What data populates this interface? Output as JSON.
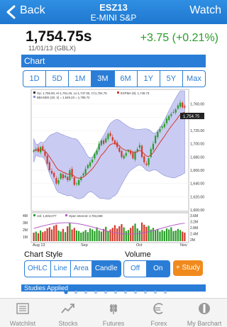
{
  "nav": {
    "back_label": "Back",
    "title": "ESZ13",
    "subtitle": "E-MINI S&P",
    "watch_label": "Watch"
  },
  "quote": {
    "price": "1,754.75s",
    "date": "11/01/13 (GBLX)",
    "change": "+3.75 (+0.21%)"
  },
  "chart_section": {
    "title": "Chart"
  },
  "ranges": [
    "1D",
    "5D",
    "1M",
    "3M",
    "6M",
    "1Y",
    "5Y",
    "Max"
  ],
  "selected_range": "3M",
  "legend": {
    "ohlc": "Op: 1,755.50, Hi:1,761.25, Lo:1,747.00, Cl:1,754.75",
    "bbands": "BBANDS (20, 2) = 1,649.23 = 1,795.72",
    "expma": "EXPMA (9): 1,749.73",
    "vol": "Vol: 1,603,077",
    "oi": "Open Interest: 2,784,838"
  },
  "price_axis": [
    "1,760.00",
    "1,740.00",
    "1,720.00",
    "1,700.00",
    "1,680.00",
    "1,660.00",
    "1,640.00",
    "1,620.00",
    "1,600.00"
  ],
  "last_price_tag": "1,754.75",
  "volume_axis_left": [
    "4M",
    "3M",
    "2M",
    "1M"
  ],
  "volume_axis_right": [
    "3.6M",
    "3.2M",
    "2.8M",
    "2.4M",
    "2M"
  ],
  "x_labels": [
    "Aug 13",
    "Sep",
    "Oct",
    "Nov"
  ],
  "chart_style": {
    "label": "Chart Style",
    "options": [
      "OHLC",
      "Line",
      "Area",
      "Candle"
    ],
    "selected": "Candle"
  },
  "volume_ctl": {
    "label": "Volume",
    "options": [
      "Off",
      "On"
    ],
    "selected": "On"
  },
  "study_button": "+ Study",
  "studies_applied": "Studies Applied",
  "tabs": [
    {
      "label": "Watchlist",
      "icon": "watchlist-icon"
    },
    {
      "label": "Stocks",
      "icon": "stocks-icon"
    },
    {
      "label": "Futures",
      "icon": "futures-icon"
    },
    {
      "label": "Forex",
      "icon": "forex-icon"
    },
    {
      "label": "My Barchart",
      "icon": "barchart-icon"
    }
  ],
  "colors": {
    "accent": "#2a7dd6",
    "up": "#2a9d2a",
    "down": "#d33a2c",
    "study": "#f08a1d"
  },
  "chart_data": {
    "type": "candlestick",
    "x_ticks": [
      "Aug 13",
      "Sep",
      "Oct",
      "Nov"
    ],
    "ylim": [
      1600,
      1780
    ],
    "closes": [
      1690,
      1692,
      1688,
      1695,
      1690,
      1682,
      1670,
      1660,
      1655,
      1650,
      1640,
      1645,
      1655,
      1648,
      1652,
      1645,
      1660,
      1650,
      1638,
      1640,
      1645,
      1650,
      1655,
      1662,
      1668,
      1672,
      1676,
      1685,
      1690,
      1700,
      1705,
      1700,
      1708,
      1715,
      1712,
      1705,
      1700,
      1695,
      1688,
      1680,
      1682,
      1686,
      1690,
      1685,
      1678,
      1688,
      1692,
      1698,
      1680,
      1672,
      1668,
      1678,
      1692,
      1700,
      1712,
      1718,
      1722,
      1726,
      1730,
      1738,
      1742,
      1745,
      1748,
      1752,
      1758,
      1762,
      1755,
      1754.75
    ],
    "volume": [
      1.6,
      1.8,
      1.5,
      2.0,
      1.7,
      1.9,
      2.4,
      2.6,
      2.2,
      2.9,
      3.1,
      2.0,
      1.8,
      2.3,
      1.7,
      2.8,
      3.4,
      2.2,
      2.5,
      2.0,
      1.9,
      1.6,
      1.8,
      2.1,
      1.7,
      2.4,
      2.2,
      1.9,
      2.6,
      2.0,
      1.8,
      2.3,
      2.7,
      1.9,
      2.2,
      2.5,
      3.0,
      2.4,
      2.8,
      3.2,
      2.6,
      1.9,
      2.1,
      2.5,
      2.9,
      3.3,
      2.4,
      2.0,
      3.5,
      3.1,
      2.7,
      2.9,
      2.2,
      2.5,
      2.0,
      2.3,
      1.8,
      2.1,
      1.9,
      2.4,
      2.2,
      2.6,
      1.9,
      2.0,
      2.3,
      2.1,
      1.8,
      1.6
    ]
  }
}
